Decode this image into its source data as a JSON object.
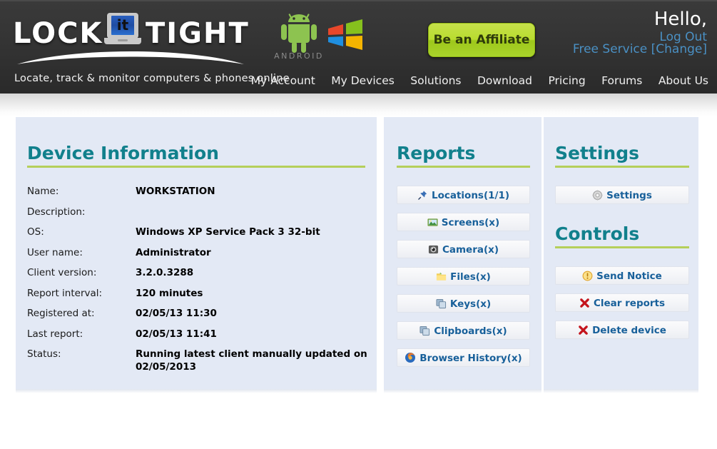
{
  "header": {
    "logo": {
      "word_left": "LOCK",
      "word_right": "TIGHT",
      "laptop_text": "it",
      "tagline": "Locate, track & monitor computers & phones online"
    },
    "os_logos": {
      "android_label": "ANDROID",
      "windows_label": "windows-logo"
    },
    "affiliate_button": "Be an Affiliate",
    "account": {
      "greeting": "Hello,",
      "logout": "Log Out",
      "service": "Free Service",
      "change": "[Change]"
    },
    "nav": [
      "My Account",
      "My Devices",
      "Solutions",
      "Download",
      "Pricing",
      "Forums",
      "About Us"
    ]
  },
  "device_information": {
    "title": "Device Information",
    "rows": [
      {
        "label": "Name:",
        "value": "WORKSTATION"
      },
      {
        "label": "Description:",
        "value": ""
      },
      {
        "label": "OS:",
        "value": "Windows XP Service Pack 3 32-bit"
      },
      {
        "label": "User name:",
        "value": "Administrator"
      },
      {
        "label": "Client version:",
        "value": "3.2.0.3288"
      },
      {
        "label": "Report interval:",
        "value": "120 minutes"
      },
      {
        "label": "Registered at:",
        "value": "02/05/13 11:30"
      },
      {
        "label": "Last report:",
        "value": "02/05/13 11:41"
      },
      {
        "label": "Status:",
        "value": "Running latest client manually updated on\n02/05/2013"
      }
    ]
  },
  "reports": {
    "title": "Reports",
    "buttons": [
      {
        "label": "Locations(1/1)",
        "icon": "pin-icon"
      },
      {
        "label": "Screens(x)",
        "icon": "image-icon"
      },
      {
        "label": "Camera(x)",
        "icon": "camera-icon"
      },
      {
        "label": "Files(x)",
        "icon": "folder-icon"
      },
      {
        "label": "Keys(x)",
        "icon": "keys-icon"
      },
      {
        "label": "Clipboards(x)",
        "icon": "clipboard-icon"
      },
      {
        "label": "Browser History(x)",
        "icon": "browser-icon"
      }
    ]
  },
  "settings": {
    "title": "Settings",
    "buttons": [
      {
        "label": "Settings",
        "icon": "gear-icon"
      }
    ]
  },
  "controls": {
    "title": "Controls",
    "buttons": [
      {
        "label": "Send Notice",
        "icon": "alert-icon"
      },
      {
        "label": "Clear reports",
        "icon": "red-x-icon"
      },
      {
        "label": "Delete device",
        "icon": "red-x-icon"
      }
    ]
  },
  "colors": {
    "header_bg": "#333333",
    "panel_bg": "#e3e9f5",
    "heading_teal": "#11808c",
    "rule_green": "#b5cf5a",
    "link_blue": "#18609a",
    "affiliate_green": "#b9dc2f",
    "nav_text": "#f0f0f0",
    "account_blue": "#4a90c4"
  }
}
